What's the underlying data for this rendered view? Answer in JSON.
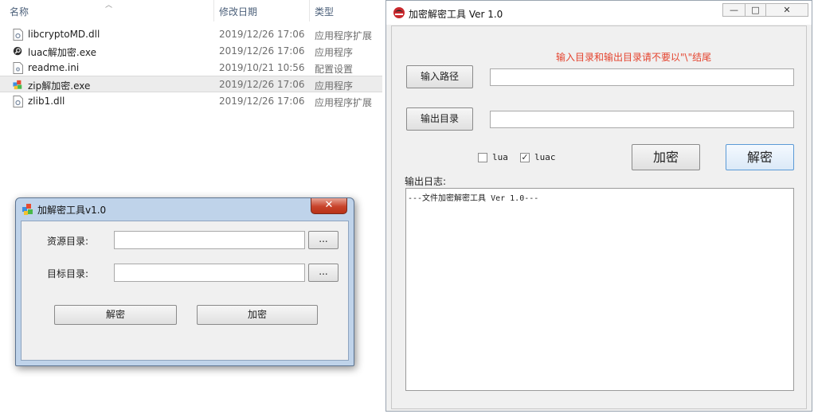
{
  "explorer": {
    "columns": {
      "name": "名称",
      "modified": "修改日期",
      "type": "类型"
    },
    "files": [
      {
        "icon": "dll-file-icon",
        "name": "libcryptoMD.dll",
        "modified": "2019/12/26 17:06",
        "type": "应用程序扩展"
      },
      {
        "icon": "exe-file-icon",
        "name": "luac解加密.exe",
        "modified": "2019/12/26 17:06",
        "type": "应用程序"
      },
      {
        "icon": "ini-file-icon",
        "name": "readme.ini",
        "modified": "2019/10/21 10:56",
        "type": "配置设置"
      },
      {
        "icon": "app-file-icon",
        "name": "zip解加密.exe",
        "modified": "2019/12/26 17:06",
        "type": "应用程序"
      },
      {
        "icon": "dll-file-icon",
        "name": "zlib1.dll",
        "modified": "2019/12/26 17:06",
        "type": "应用程序扩展"
      }
    ]
  },
  "small_window": {
    "title": "加解密工具v1.0",
    "close_glyph": "✕",
    "source_label": "资源目录:",
    "target_label": "目标目录:",
    "source_value": "",
    "target_value": "",
    "browse_label": "...",
    "decrypt_label": "解密",
    "encrypt_label": "加密"
  },
  "main_window": {
    "title": "加密解密工具 Ver 1.0",
    "controls": {
      "minimize": "—",
      "maximize": "□",
      "close": "✕"
    },
    "warning": "输入目录和输出目录请不要以\"\\\"结尾",
    "input_path_button": "输入路径",
    "output_dir_button": "输出目录",
    "input_path_value": "",
    "output_dir_value": "",
    "checkbox_lua": {
      "label": "lua",
      "checked": false
    },
    "checkbox_luac": {
      "label": "luac",
      "checked": true,
      "check_glyph": "✓"
    },
    "encrypt_button": "加密",
    "decrypt_button": "解密",
    "log_label": "输出日志:",
    "log_text": "---文件加密解密工具 Ver 1.0---",
    "warning_color": "#e4432e"
  }
}
